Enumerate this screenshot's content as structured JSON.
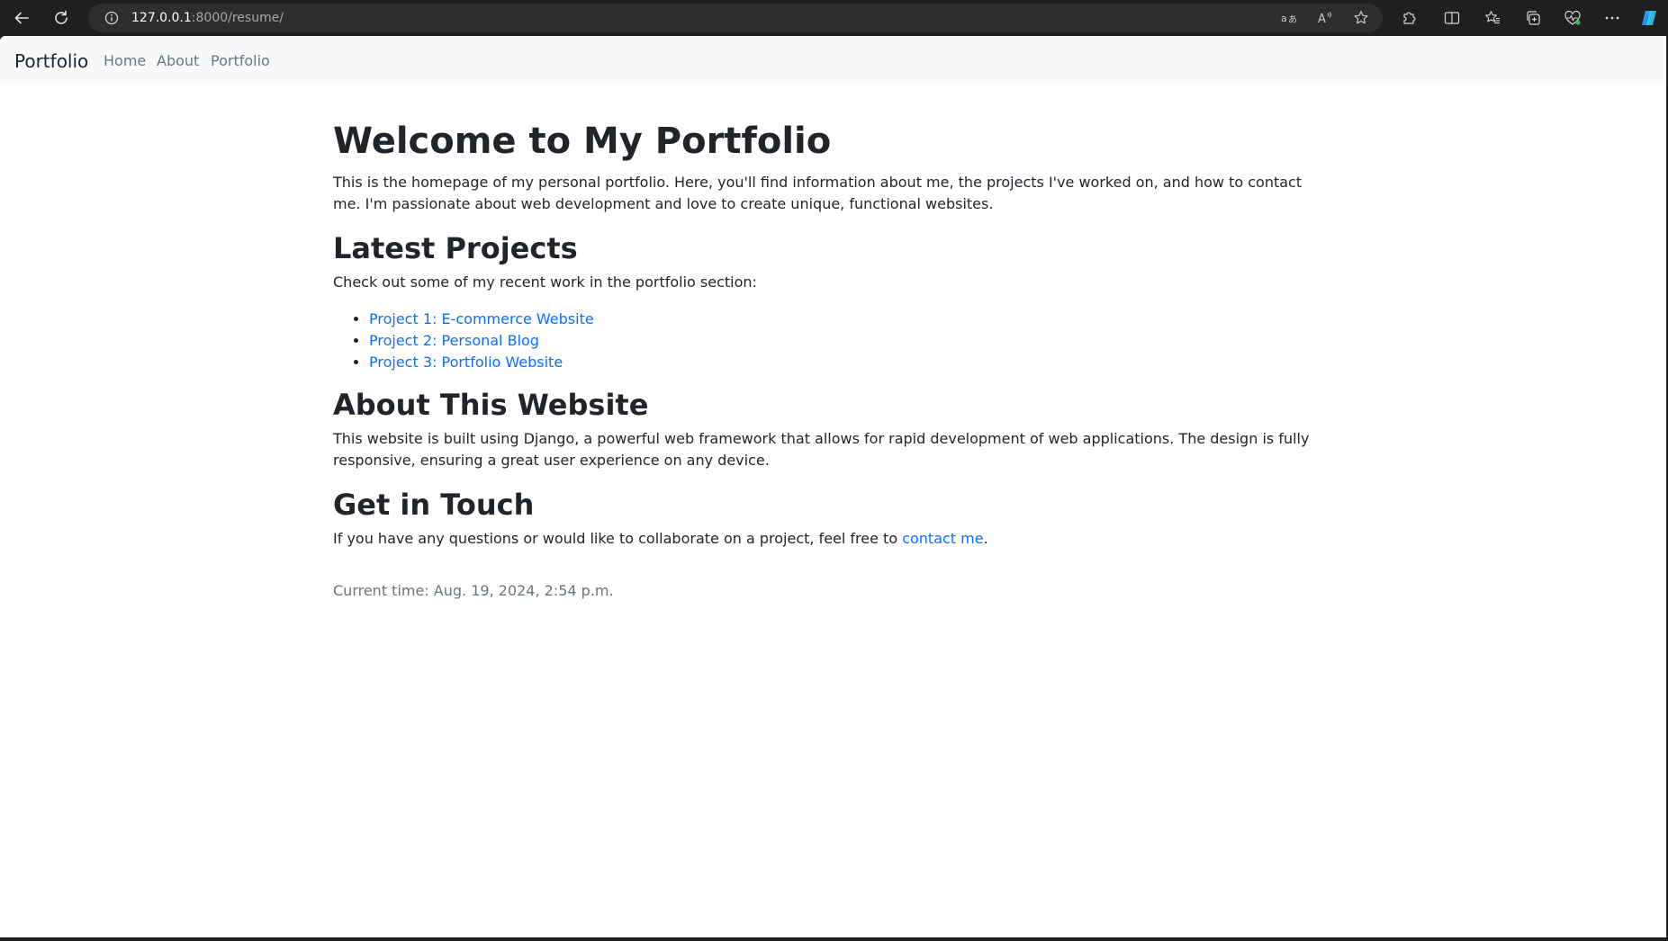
{
  "browser": {
    "url_host": "127.0.0.1",
    "url_path": ":8000/resume/",
    "icons": {
      "back": "back-arrow-icon",
      "reload": "reload-icon",
      "site_info": "info-icon",
      "translate": "translate-icon",
      "read_aloud": "read-aloud-icon",
      "favorite": "star-icon",
      "extensions": "puzzle-icon",
      "split_screen": "split-screen-icon",
      "favorites": "favorites-icon",
      "collections": "collections-icon",
      "browser_essentials": "heart-pulse-icon",
      "more": "more-dots-icon",
      "copilot": "copilot-icon"
    }
  },
  "navbar": {
    "brand": "Portfolio",
    "links": [
      "Home",
      "About",
      "Portfolio"
    ]
  },
  "page": {
    "title": "Welcome to My Portfolio",
    "intro": "This is the homepage of my personal portfolio. Here, you'll find information about me, the projects I've worked on, and how to contact me. I'm passionate about web development and love to create unique, functional websites.",
    "projects_heading": "Latest Projects",
    "projects_text": "Check out some of my recent work in the portfolio section:",
    "projects": [
      "Project 1: E-commerce Website",
      "Project 2: Personal Blog",
      "Project 3: Portfolio Website"
    ],
    "about_heading": "About This Website",
    "about_text": "This website is built using Django, a powerful web framework that allows for rapid development of web applications. The design is fully responsive, ensuring a great user experience on any device.",
    "contact_heading": "Get in Touch",
    "contact_text_before": "If you have any questions or would like to collaborate on a project, feel free to ",
    "contact_link": "contact me",
    "contact_text_after": ".",
    "current_time": "Current time: Aug. 19, 2024, 2:54 p.m."
  },
  "colors": {
    "link": "#0d6efd",
    "text": "#212529",
    "muted": "#6c757d",
    "navbar_bg": "#f8f9fa",
    "chrome_bg": "#1f1f1f"
  }
}
